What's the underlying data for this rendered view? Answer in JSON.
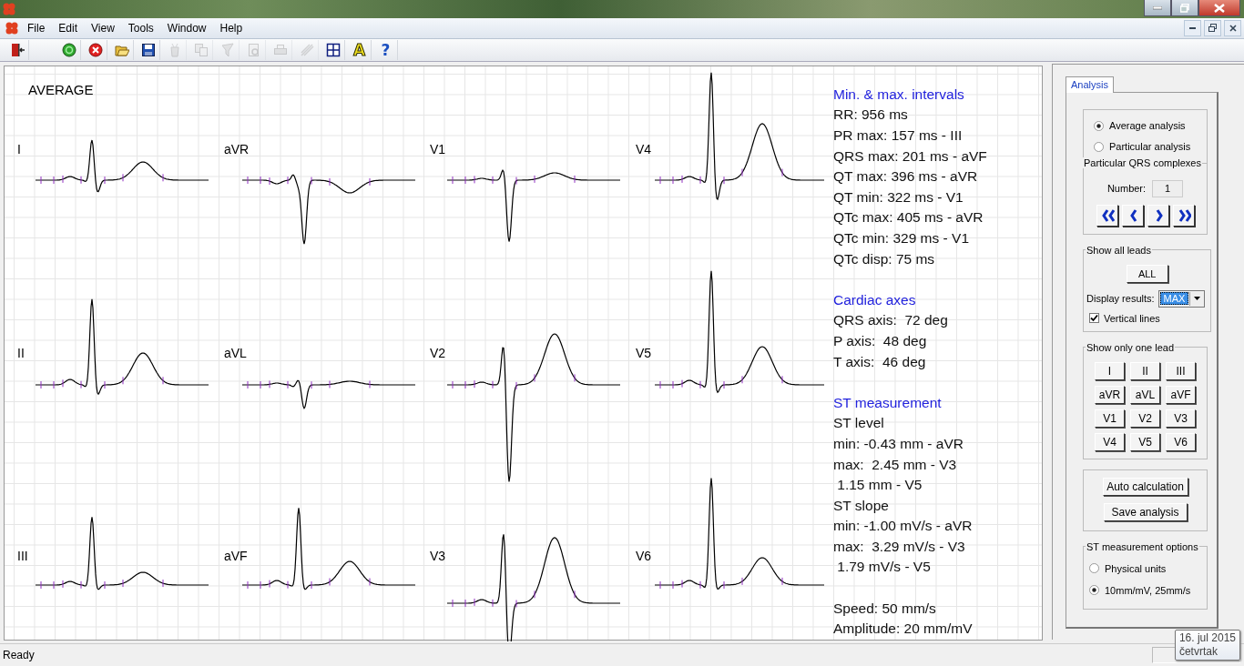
{
  "menu": [
    "File",
    "Edit",
    "View",
    "Tools",
    "Window",
    "Help"
  ],
  "toolbar": [
    {
      "kind": "exit",
      "disabled": false
    },
    {
      "kind": "run",
      "disabled": false
    },
    {
      "kind": "stop",
      "disabled": false
    },
    {
      "kind": "open",
      "disabled": false
    },
    {
      "kind": "save",
      "disabled": false
    },
    {
      "kind": "trash",
      "disabled": true
    },
    {
      "kind": "copy",
      "disabled": true
    },
    {
      "kind": "filter",
      "disabled": true
    },
    {
      "kind": "preview",
      "disabled": true
    },
    {
      "kind": "print",
      "disabled": true
    },
    {
      "kind": "measure",
      "disabled": true
    },
    {
      "kind": "grid",
      "disabled": false
    },
    {
      "kind": "font",
      "glyph": "A",
      "disabled": false
    },
    {
      "kind": "help",
      "glyph": "?",
      "disabled": false
    }
  ],
  "ecg": {
    "title": "AVERAGE",
    "leads": [
      {
        "label": "I"
      },
      {
        "label": "aVR"
      },
      {
        "label": "V1"
      },
      {
        "label": "V4"
      },
      {
        "label": "II"
      },
      {
        "label": "aVL"
      },
      {
        "label": "V2"
      },
      {
        "label": "V5"
      },
      {
        "label": "III"
      },
      {
        "label": "aVF"
      },
      {
        "label": "V3"
      },
      {
        "label": "V6"
      }
    ]
  },
  "measurements": [
    {
      "heading": "Min. & max. intervals",
      "lines": [
        "RR: 956 ms",
        "PR max: 157 ms - III",
        "QRS max: 201 ms - aVF",
        "QT max: 396 ms - aVR",
        "QT min: 322 ms - V1",
        "QTc max: 405 ms - aVR",
        "QTc min: 329 ms - V1",
        "QTc disp: 75 ms"
      ]
    },
    {
      "heading": "Cardiac axes",
      "lines": [
        "QRS axis:  72 deg",
        "P axis:  48 deg",
        "T axis:  46 deg"
      ]
    },
    {
      "heading": "ST measurement",
      "lines": [
        "ST level",
        "min: -0.43 mm - aVR",
        "max:  2.45 mm - V3",
        " 1.15 mm - V5",
        "ST slope",
        "min: -1.00 mV/s - aVR",
        "max:  3.29 mV/s - V3",
        " 1.79 mV/s - V5"
      ]
    },
    {
      "lines": [
        "Speed: 50 mm/s",
        "Amplitude: 20 mm/mV"
      ]
    }
  ],
  "side_panel": {
    "tab": {
      "label": "Analysis",
      "selected": true
    },
    "analysis_mode": [
      {
        "label": "Average analysis",
        "selected": true
      },
      {
        "label": "Particular analysis",
        "selected": false
      }
    ],
    "qrs_group": {
      "title": "Particular QRS complexes",
      "number_label": "Number:",
      "number": "1"
    },
    "show_all": {
      "title": "Show all leads",
      "button": "ALL",
      "display_label": "Display results:",
      "display_value": "MAX",
      "vertical_lines": {
        "label": "Vertical lines",
        "checked": true
      }
    },
    "one_lead": {
      "title": "Show only one lead",
      "buttons": [
        "I",
        "II",
        "III",
        "aVR",
        "aVL",
        "aVF",
        "V1",
        "V2",
        "V3",
        "V4",
        "V5",
        "V6"
      ]
    },
    "actions": [
      "Auto calculation",
      "Save analysis"
    ],
    "st_options": {
      "title": "ST measurement options",
      "options": [
        {
          "label": "Physical units",
          "selected": false
        },
        {
          "label": "10mm/mV, 25mm/s",
          "selected": true
        }
      ]
    }
  },
  "status_bar": {
    "text": "Ready"
  },
  "date_tooltip": [
    "16. jul 2015",
    "četvrtak"
  ]
}
